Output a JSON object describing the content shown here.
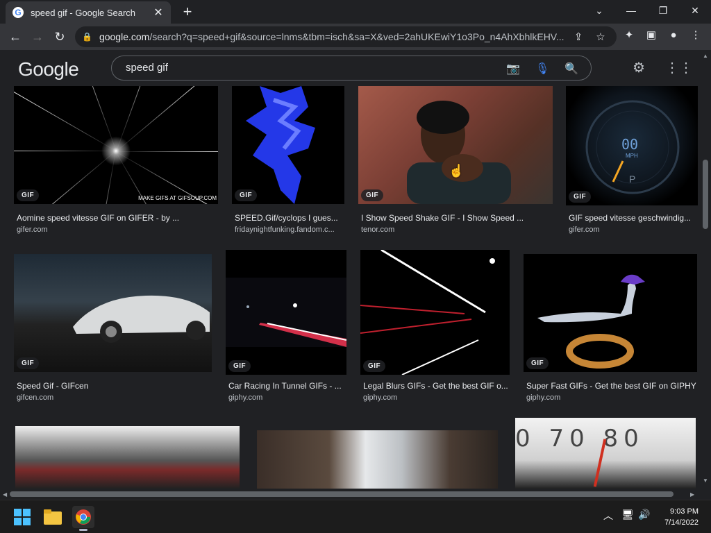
{
  "browser": {
    "tab_title": "speed gif - Google Search",
    "tab_favicon": "G",
    "new_tab_symbol": "+",
    "url_domain": "google.com",
    "url_path": "/search?q=speed+gif&source=lnms&tbm=isch&sa=X&ved=2ahUKEwiY1o3Po_n4AhXbhlkEHV..."
  },
  "google": {
    "logo": "Google",
    "query": "speed gif"
  },
  "results": [
    {
      "badge": "GIF",
      "title": "Aomine speed vitesse GIF on GIFER - by ...",
      "source": "gifer.com",
      "overlay_text": "MAKE GIFS AT GIFSOUP.COM"
    },
    {
      "badge": "GIF",
      "title": "SPEED.Gif/cyclops I gues...",
      "source": "fridaynightfunking.fandom.c..."
    },
    {
      "badge": "GIF",
      "title": "I Show Speed Shake GIF - I Show Speed ...",
      "source": "tenor.com"
    },
    {
      "badge": "GIF",
      "title": "GIF speed vitesse geschwindig...",
      "source": "gifer.com",
      "gauge_value": "00",
      "gauge_unit": "MPH",
      "gauge_gear": "P"
    },
    {
      "badge": "GIF",
      "title": "Speed Gif - GIFcen",
      "source": "gifcen.com"
    },
    {
      "badge": "GIF",
      "title": "Car Racing In Tunnel GIFs - ...",
      "source": "giphy.com"
    },
    {
      "badge": "GIF",
      "title": "Legal Blurs GIFs - Get the best GIF o...",
      "source": "giphy.com"
    },
    {
      "badge": "GIF",
      "title": "Super Fast GIFs - Get the best GIF on GIPHY",
      "source": "giphy.com"
    },
    {
      "speedo_text": "0 70 80"
    }
  ],
  "taskbar": {
    "time": "9:03 PM",
    "date": "7/14/2022"
  },
  "colors": {
    "background": "#202124",
    "toolbar": "#35363a",
    "text": "#e8eaed",
    "subtext": "#bdc1c6",
    "mic_blue": "#4285f4"
  },
  "icons": [
    "google-favicon",
    "close-icon",
    "plus-icon",
    "chevron-down-icon",
    "minimize-icon",
    "restore-icon",
    "window-close-icon",
    "back-arrow-icon",
    "forward-arrow-icon",
    "reload-icon",
    "lock-icon",
    "share-icon",
    "star-icon",
    "extensions-icon",
    "side-panel-icon",
    "profile-icon",
    "kebab-menu-icon",
    "camera-icon",
    "mic-icon",
    "search-icon",
    "gear-icon",
    "apps-grid-icon",
    "windows-start-icon",
    "file-explorer-icon",
    "chrome-icon",
    "chevron-up-icon",
    "network-icon",
    "volume-icon",
    "hand-cursor-icon"
  ]
}
